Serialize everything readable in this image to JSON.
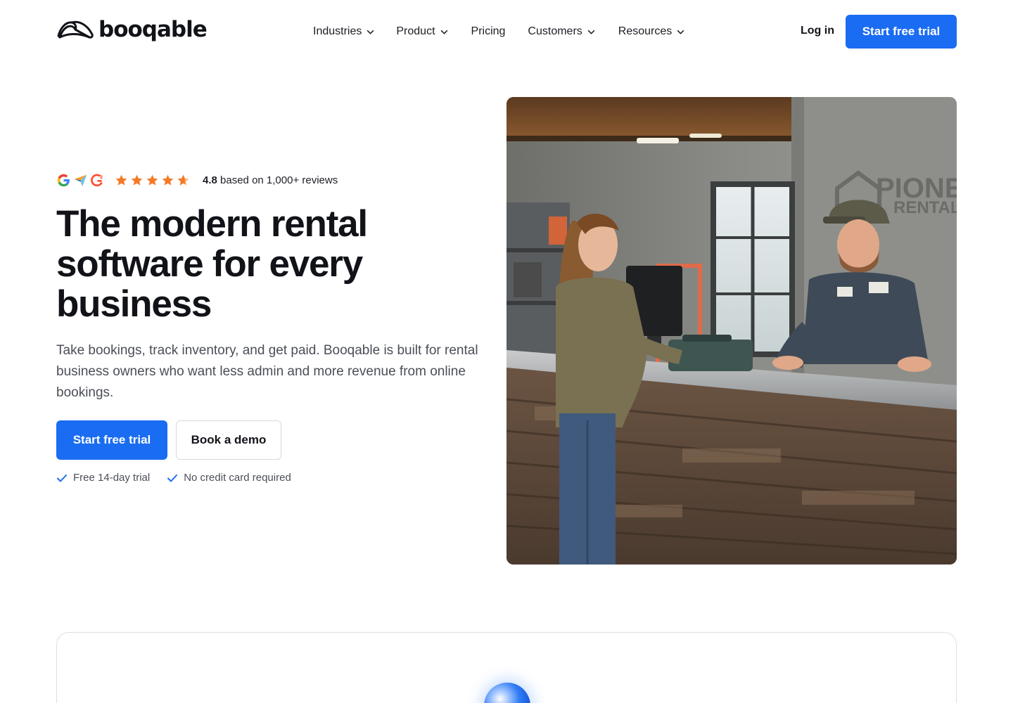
{
  "brand": {
    "name": "booqable",
    "logo_icon": "booqable-arch-logo"
  },
  "nav": {
    "items": [
      {
        "label": "Industries",
        "has_dropdown": true
      },
      {
        "label": "Product",
        "has_dropdown": true
      },
      {
        "label": "Pricing",
        "has_dropdown": false
      },
      {
        "label": "Customers",
        "has_dropdown": true
      },
      {
        "label": "Resources",
        "has_dropdown": true
      }
    ],
    "login_label": "Log in",
    "cta_label": "Start free trial"
  },
  "hero": {
    "rating": {
      "sources": [
        "google-icon",
        "capterra-icon",
        "g2-icon"
      ],
      "stars": 4.8,
      "score": "4.8",
      "text": "based on 1,000+ reviews"
    },
    "title": "The modern rental software for every business",
    "subtitle": "Take bookings, track inventory, and get paid. Booqable is built for rental business owners who want less admin and more revenue from online bookings.",
    "primary_cta": "Start free trial",
    "secondary_cta": "Book a demo",
    "checks": [
      "Free 14-day trial",
      "No credit card required"
    ],
    "image": {
      "signage": {
        "line1": "PIONEE",
        "line2": "RENTALS"
      }
    }
  },
  "colors": {
    "accent": "#1a6cf2",
    "text": "#111318",
    "muted": "#4a4e57",
    "star": "#f47a26"
  }
}
